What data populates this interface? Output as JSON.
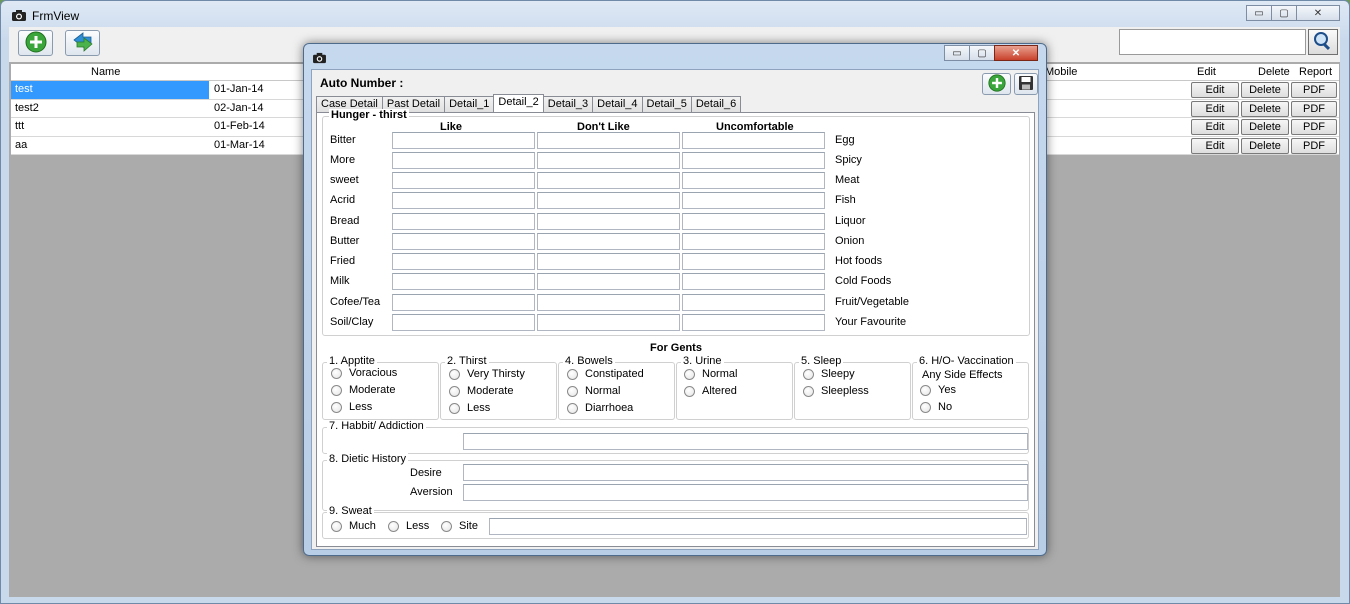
{
  "main_window": {
    "title": "FrmView",
    "controls": {
      "minimize": "▭",
      "maximize": "▢",
      "close": "✕"
    }
  },
  "grid": {
    "headers": {
      "name": "Name",
      "mobile": "Mobile",
      "edit": "Edit",
      "delete": "Delete",
      "report": "Report"
    },
    "rows": [
      {
        "name": "test",
        "date": "01-Jan-14",
        "edit": "Edit",
        "delete": "Delete",
        "report": "PDF"
      },
      {
        "name": "test2",
        "date": "02-Jan-14",
        "edit": "Edit",
        "delete": "Delete",
        "report": "PDF"
      },
      {
        "name": "ttt",
        "date": "01-Feb-14",
        "edit": "Edit",
        "delete": "Delete",
        "report": "PDF"
      },
      {
        "name": "aa",
        "date": "01-Mar-14",
        "edit": "Edit",
        "delete": "Delete",
        "report": "PDF"
      }
    ]
  },
  "dialog": {
    "controls": {
      "minimize": "▭",
      "maximize": "▢",
      "close": "✕"
    },
    "auto_number_label": "Auto Number :",
    "tabs": [
      "Case Detail",
      "Past Detail",
      "Detail_1",
      "Detail_2",
      "Detail_3",
      "Detail_4",
      "Detail_5",
      "Detail_6"
    ],
    "hunger": {
      "title": "Hunger - thirst",
      "col_like": "Like",
      "col_dont_like": "Don't Like",
      "col_uncomfortable": "Uncomfortable",
      "rows": [
        {
          "left": "Bitter",
          "right": "Egg"
        },
        {
          "left": "More",
          "right": "Spicy"
        },
        {
          "left": "sweet",
          "right": "Meat"
        },
        {
          "left": "Acrid",
          "right": "Fish"
        },
        {
          "left": "Bread",
          "right": "Liquor"
        },
        {
          "left": "Butter",
          "right": "Onion"
        },
        {
          "left": "Fried",
          "right": "Hot foods"
        },
        {
          "left": "Milk",
          "right": "Cold Foods"
        },
        {
          "left": "Cofee/Tea",
          "right": "Fruit/Vegetable"
        },
        {
          "left": "Soil/Clay",
          "right": "Your Favourite"
        }
      ]
    },
    "for_gents": "For Gents",
    "groups": [
      {
        "title": "1. Apptite",
        "options": [
          "Voracious",
          "Moderate",
          "Less"
        ]
      },
      {
        "title": "2. Thirst",
        "options": [
          "Very Thirsty",
          "Moderate",
          "Less"
        ]
      },
      {
        "title": "4. Bowels",
        "options": [
          "Constipated",
          "Normal",
          "Diarrhoea"
        ]
      },
      {
        "title": "3. Urine",
        "options": [
          "Normal",
          "Altered"
        ]
      },
      {
        "title": "5. Sleep",
        "options": [
          "Sleepy",
          "Sleepless"
        ]
      },
      {
        "title": "6. H/O- Vaccination",
        "subtitle": "Any Side Effects",
        "options": [
          "Yes",
          "No"
        ]
      }
    ],
    "habbit": {
      "title": "7. Habbit/ Addiction"
    },
    "dietic": {
      "title": "8. Dietic History",
      "desire": "Desire",
      "aversion": "Aversion"
    },
    "sweat": {
      "title": "9. Sweat",
      "options": [
        "Much",
        "Less",
        "Site"
      ]
    }
  }
}
